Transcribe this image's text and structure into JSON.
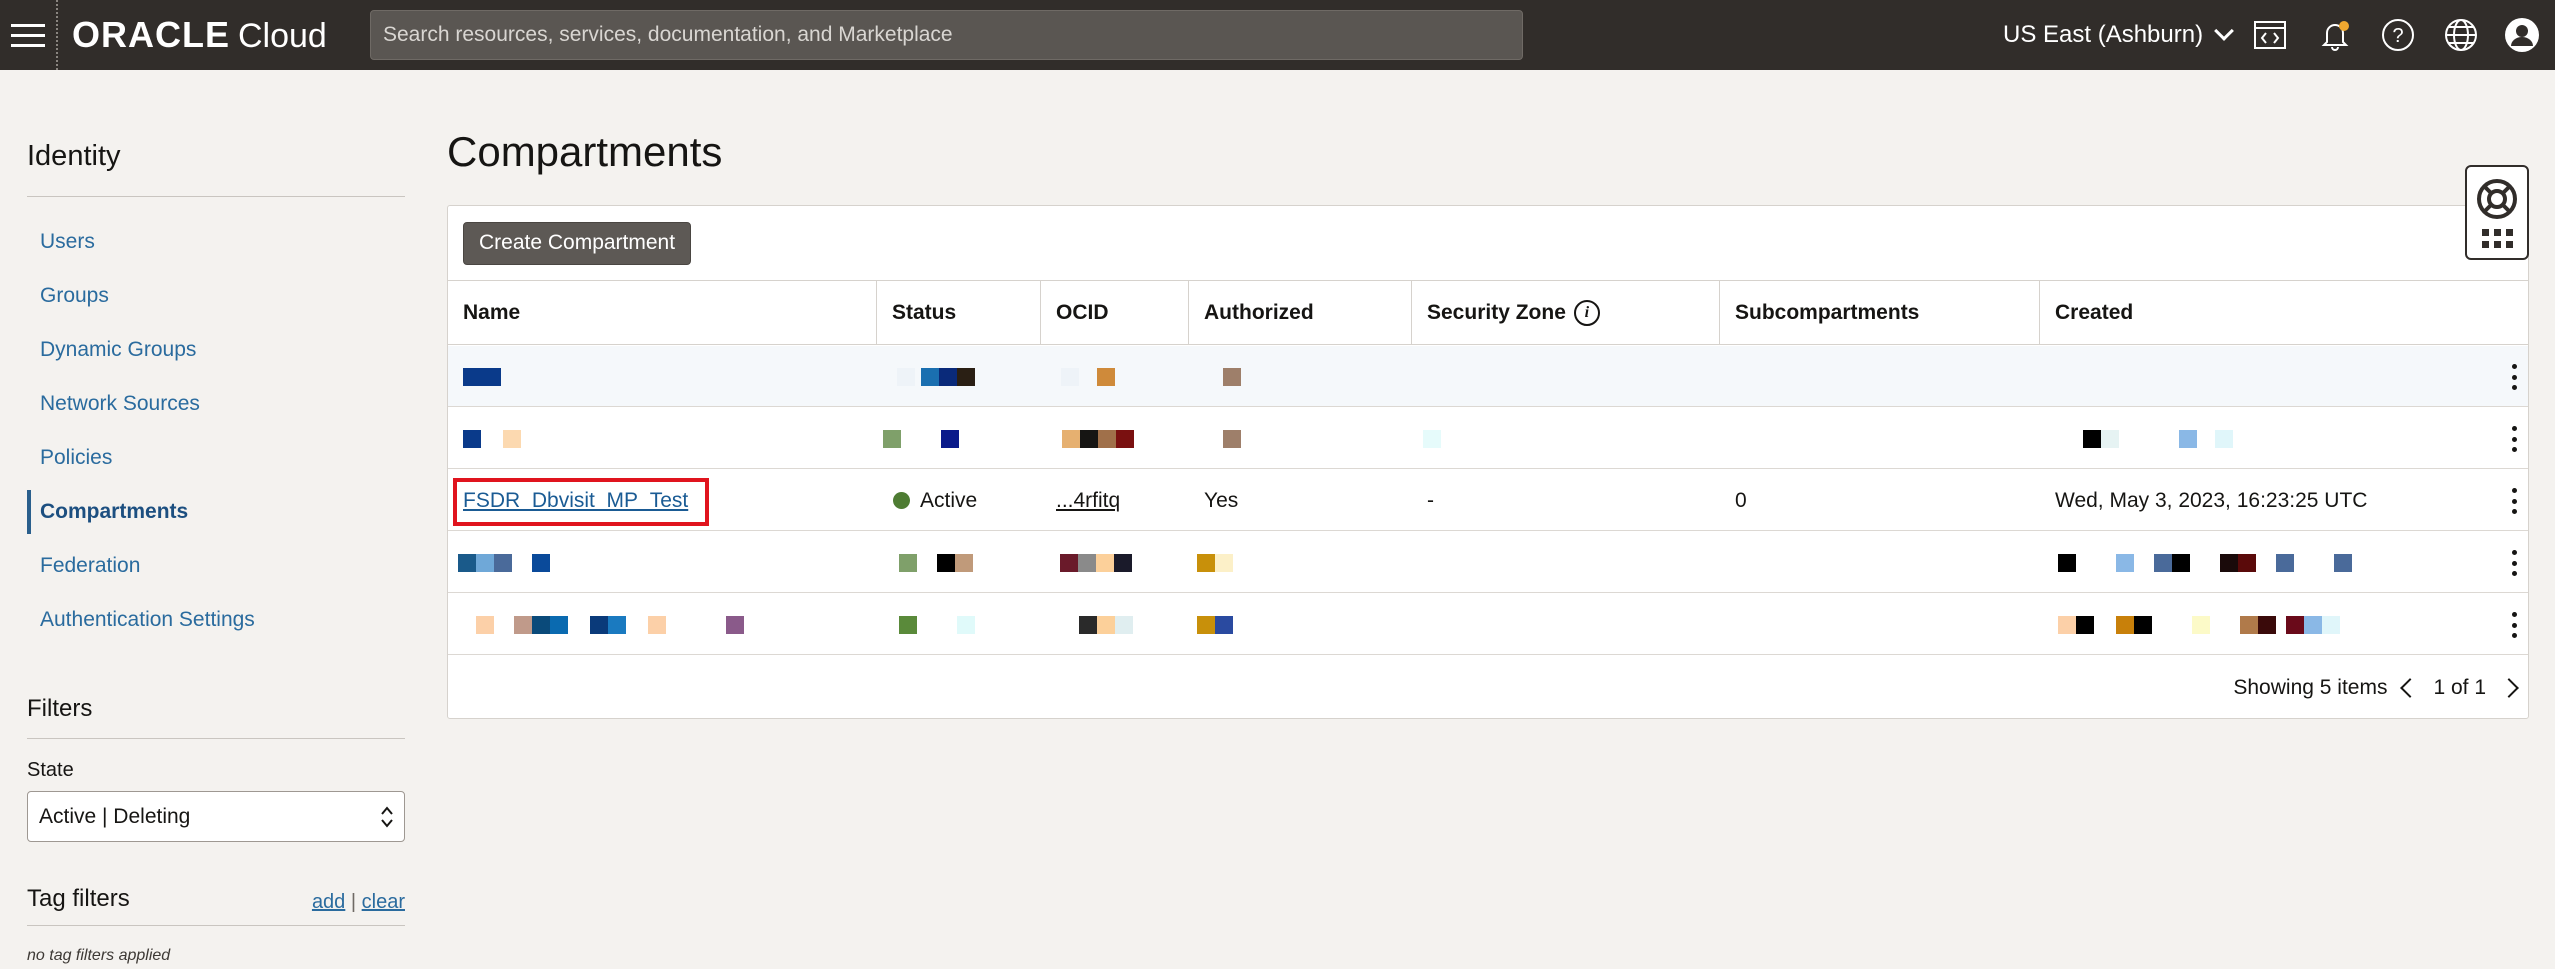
{
  "topbar": {
    "brand_oracle": "ORACLE",
    "brand_cloud": "Cloud",
    "search_placeholder": "Search resources, services, documentation, and Marketplace",
    "region": "US East (Ashburn)",
    "icons": [
      "code-editor-icon",
      "bell-icon",
      "help-icon",
      "globe-icon",
      "user-icon"
    ]
  },
  "sidebar": {
    "title": "Identity",
    "items": [
      {
        "label": "Users"
      },
      {
        "label": "Groups"
      },
      {
        "label": "Dynamic Groups"
      },
      {
        "label": "Network Sources"
      },
      {
        "label": "Policies"
      },
      {
        "label": "Compartments",
        "active": true
      },
      {
        "label": "Federation"
      },
      {
        "label": "Authentication Settings"
      }
    ],
    "filters_title": "Filters",
    "state_label": "State",
    "state_value": "Active | Deleting",
    "tag_filters_title": "Tag filters",
    "tag_add": "add",
    "tag_sep": "|",
    "tag_clear": "clear",
    "no_tags": "no tag filters applied"
  },
  "main": {
    "title": "Compartments",
    "create_button": "Create Compartment",
    "columns": [
      "Name",
      "Status",
      "OCID",
      "Authorized",
      "Security Zone",
      "Subcompartments",
      "Created"
    ],
    "rows": [
      {
        "redacted": true
      },
      {
        "redacted": true
      },
      {
        "name": "FSDR_Dbvisit_MP_Test",
        "status": "Active",
        "ocid": "...4rfitq",
        "authorized": "Yes",
        "security_zone": "-",
        "subcompartments": "0",
        "created": "Wed, May 3, 2023, 16:23:25 UTC"
      },
      {
        "redacted": true
      },
      {
        "redacted": true
      }
    ],
    "showing": "Showing 5 items",
    "pagination": "1 of 1"
  },
  "colors": {
    "topbar": "#312d2a",
    "link": "#1a5b94",
    "active_status": "#4e7c33",
    "highlight": "#e0141e"
  }
}
